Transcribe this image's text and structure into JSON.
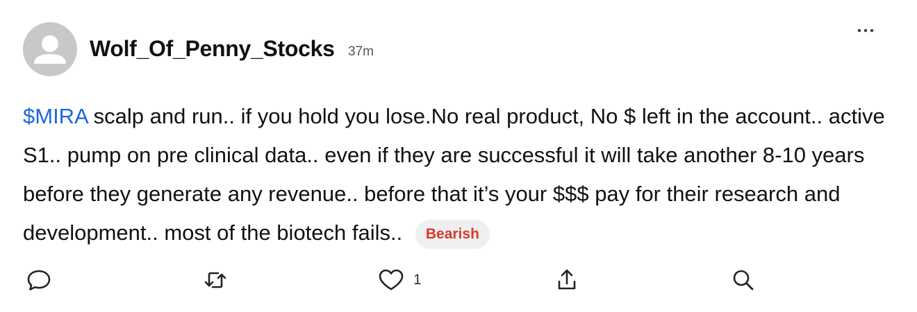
{
  "post": {
    "username": "Wolf_Of_Penny_Stocks",
    "timestamp": "37m",
    "ticker": "$MIRA",
    "body": " scalp and run.. if you hold you lose.No real product, No $ left in the account.. active S1.. pump on pre clinical data.. even if they are successful it will take another 8-10 years before they generate any revenue.. before that it’s your $$$ pay for their research and development.. most of the biotech fails.. ",
    "sentiment": "Bearish"
  },
  "actions": {
    "like_count": "1",
    "icons": [
      "comment-icon",
      "repost-icon",
      "heart-icon",
      "share-icon",
      "search-icon"
    ]
  },
  "menu": {
    "icon": "more-dots-icon"
  },
  "colors": {
    "ticker": "#1a66e6",
    "bearish_text": "#d83a2c",
    "bearish_bg": "#efefef",
    "avatar_bg": "#c8c8c8",
    "icon": "#222222"
  }
}
